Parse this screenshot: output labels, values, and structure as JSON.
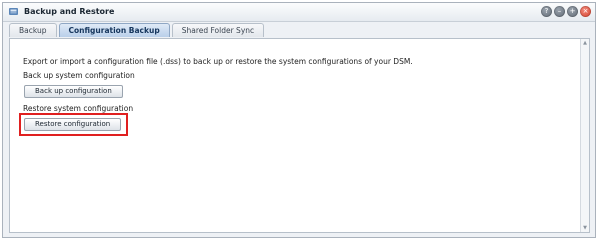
{
  "window": {
    "title": "Backup and Restore",
    "title_icon": "backup-restore-icon",
    "controls": [
      {
        "name": "help",
        "glyph": "?"
      },
      {
        "name": "minimize",
        "glyph": "–"
      },
      {
        "name": "maximize",
        "glyph": "+"
      },
      {
        "name": "close",
        "glyph": "×"
      }
    ]
  },
  "tabs": [
    {
      "label": "Backup",
      "active": false
    },
    {
      "label": "Configuration Backup",
      "active": true
    },
    {
      "label": "Shared Folder Sync",
      "active": false
    }
  ],
  "main": {
    "description": "Export or import a configuration file (.dss) to back up or restore the system configurations of your DSM.",
    "backup_section": {
      "label": "Back up system configuration",
      "button_label": "Back up configuration"
    },
    "restore_section": {
      "label": "Restore system configuration",
      "button_label": "Restore configuration"
    }
  },
  "colors": {
    "highlight": "#e02020",
    "active_tab": "#b9cfe9"
  }
}
